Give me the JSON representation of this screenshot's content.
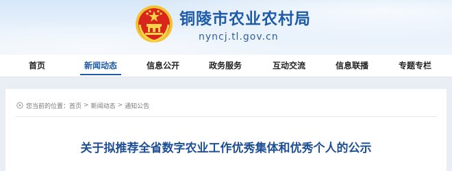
{
  "header": {
    "site_name": "铜陵市农业农村局",
    "domain": "nyncj.tl.gov.cn",
    "emblem_icon": "national-emblem-icon"
  },
  "nav": {
    "items": [
      {
        "label": "首页",
        "active": false
      },
      {
        "label": "新闻动态",
        "active": true
      },
      {
        "label": "信息公开",
        "active": false
      },
      {
        "label": "政务服务",
        "active": false
      },
      {
        "label": "互动交流",
        "active": false
      },
      {
        "label": "信息联播",
        "active": false
      },
      {
        "label": "专题专栏",
        "active": false
      }
    ]
  },
  "breadcrumb": {
    "prefix": "您当前的位置：",
    "items": [
      "首页",
      "新闻动态",
      "通知公告"
    ],
    "separator": ">"
  },
  "article": {
    "title": "关于拟推荐全省数字农业工作优秀集体和优秀个人的公示"
  },
  "colors": {
    "brand": "#1d5aa8",
    "title": "#1d4f96",
    "page_bg": "#e9eef5"
  }
}
